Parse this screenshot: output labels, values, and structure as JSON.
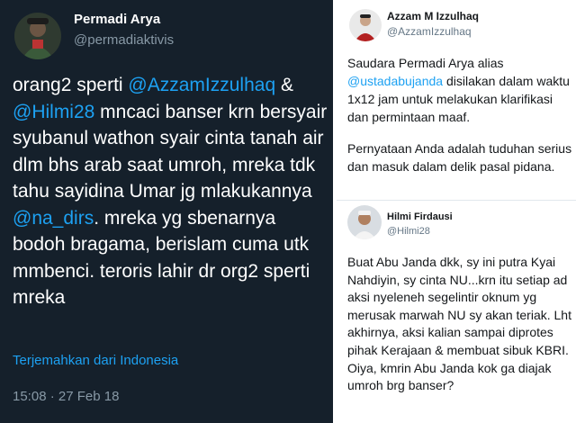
{
  "left_tweet": {
    "author_name": "Permadi Arya",
    "author_handle": "@permadiaktivis",
    "text_segments": [
      {
        "text": "orang2 sperti ",
        "type": "text"
      },
      {
        "text": "@AzzamIzzulhaq",
        "type": "mention"
      },
      {
        "text": " & ",
        "type": "text"
      },
      {
        "text": "@Hilmi28",
        "type": "mention"
      },
      {
        "text": " mncaci banser krn bersyair syubanul wathon syair cinta tanah air dlm bhs arab saat umroh, mreka tdk tahu sayidina Umar jg mlakukannya ",
        "type": "text"
      },
      {
        "text": "@na_dirs",
        "type": "mention"
      },
      {
        "text": ". mreka yg sbenarnya bodoh bragama, berislam cuma utk mmbenci. teroris lahir dr org2 sperti mreka",
        "type": "text"
      }
    ],
    "translate_link": "Terjemahkan dari Indonesia",
    "timestamp": "15:08 · 27 Feb 18",
    "avatar_icon": "user-avatar-icon"
  },
  "right_tweet_1": {
    "author_name": "Azzam M Izzulhaq",
    "author_handle": "@AzzamIzzulhaq",
    "text_pre": "Saudara Permadi Arya alias ",
    "mention": "@ustadabujanda",
    "text_post": " disilakan dalam waktu 1x12 jam untuk melakukan klarifikasi dan permintaan maaf.",
    "text_para2": "Pernyataan Anda adalah tuduhan serius dan masuk dalam delik pasal pidana.",
    "avatar_icon": "user-avatar-icon"
  },
  "right_tweet_2": {
    "author_name": "Hilmi Firdausi",
    "author_handle": "@Hilmi28",
    "text": "Buat Abu Janda dkk, sy ini putra Kyai Nahdiyin, sy cinta NU...krn itu setiap ad aksi nyeleneh segelintir oknum yg merusak marwah NU sy akan teriak. Lht akhirnya, aksi kalian sampai diprotes pihak Kerajaan & membuat sibuk KBRI. Oiya, kmrin Abu Janda kok ga diajak umroh brg banser?",
    "avatar_icon": "user-avatar-icon"
  },
  "colors": {
    "dark_background": "#15202b",
    "mention_blue": "#1da1f2",
    "secondary_gray": "#8899a6"
  }
}
